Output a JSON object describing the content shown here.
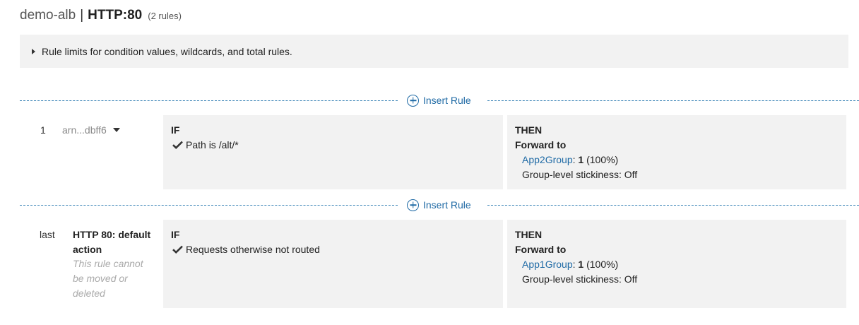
{
  "header": {
    "lb_name": "demo-alb",
    "separator": "|",
    "listener": "HTTP:80",
    "rule_count": "(2 rules)"
  },
  "limits_notice": {
    "text": "Rule limits for condition values, wildcards, and total rules."
  },
  "insert_rule_label": "Insert Rule",
  "rules": [
    {
      "priority": "1",
      "arn": "arn...dbff6",
      "if_label": "IF",
      "condition": "Path is /alt/*",
      "then_label": "THEN",
      "action": "Forward to",
      "target_group": "App2Group",
      "weight_sep": ":",
      "weight": "1",
      "weight_pct": "(100%)",
      "stickiness": "Group-level stickiness: Off"
    },
    {
      "priority": "last",
      "name": "HTTP 80: default action",
      "note": "This rule cannot be moved or deleted",
      "if_label": "IF",
      "condition": "Requests otherwise not routed",
      "then_label": "THEN",
      "action": "Forward to",
      "target_group": "App1Group",
      "weight_sep": ":",
      "weight": "1",
      "weight_pct": "(100%)",
      "stickiness": "Group-level stickiness: Off"
    }
  ],
  "colors": {
    "link": "#1f6aa5",
    "dash": "#3f87b8",
    "panel_bg": "#f2f2f2"
  },
  "icons": {
    "insert": "plus-circle-icon",
    "condition": "checkmark-icon",
    "expand": "caret-right-icon",
    "menu": "caret-down-icon"
  }
}
